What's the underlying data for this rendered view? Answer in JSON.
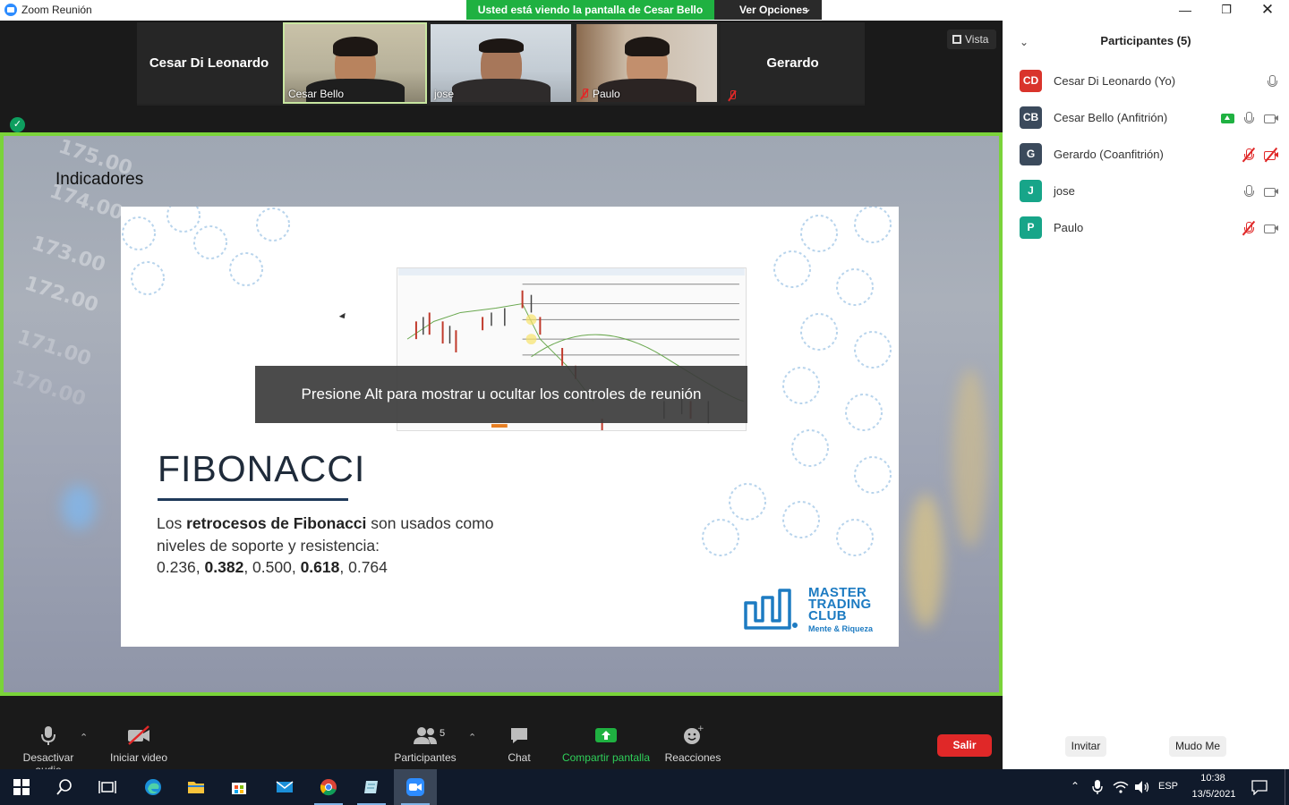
{
  "window": {
    "title": "Zoom Reunión",
    "share_banner": "Usted está viendo la pantalla de Cesar Bello",
    "view_options": "Ver Opciones"
  },
  "video_strip": {
    "tiles": [
      {
        "name": "Cesar Di Leonardo",
        "type": "name-only"
      },
      {
        "name": "Cesar Bello",
        "type": "video",
        "active": true
      },
      {
        "name": "jose",
        "type": "video"
      },
      {
        "name": "Paulo",
        "type": "video",
        "muted": true
      },
      {
        "name": "Gerardo",
        "type": "name-only",
        "muted": true
      }
    ],
    "vista_label": "Vista"
  },
  "shared_screen": {
    "section_title": "Indicadores",
    "chart_ticks": [
      "175.00",
      "174.00",
      "173.00",
      "172.00",
      "171.00",
      "170.00"
    ],
    "slide": {
      "heading": "FIBONACCI",
      "text_1": "Los ",
      "text_bold_1": "retrocesos de Fibonacci",
      "text_2": " son usados como",
      "text_3": "niveles de soporte y resistencia:",
      "v1": "0.236, ",
      "v2": "0.382",
      "v3": ", 0.500, ",
      "v4": "0.618",
      "v5": ", 0.764",
      "logo_line1": "MASTER",
      "logo_line2": "TRADING",
      "logo_line3": "CLUB",
      "logo_tagline": "Mente & Riqueza"
    },
    "toast": "Presione Alt para mostrar u ocultar los controles de reunión"
  },
  "toolbar": {
    "audio": "Desactivar audio",
    "video": "Iniciar video",
    "participants": "Participantes",
    "participants_count": "5",
    "chat": "Chat",
    "share": "Compartir pantalla",
    "reactions": "Reacciones",
    "leave": "Salir"
  },
  "panel": {
    "title": "Participantes (5)",
    "participants": [
      {
        "initials": "CD",
        "name": "Cesar Di Leonardo (Yo)",
        "color": "#d9342b"
      },
      {
        "initials": "CB",
        "name": "Cesar Bello (Anfitrión)",
        "color": "#3b4a5c"
      },
      {
        "initials": "G",
        "name": "Gerardo (Coanfitrión)",
        "color": "#3b4a5c"
      },
      {
        "initials": "J",
        "name": "jose",
        "color": "#17a589"
      },
      {
        "initials": "P",
        "name": "Paulo",
        "color": "#17a589"
      }
    ],
    "invite": "Invitar",
    "mute_me": "Mudo Me"
  },
  "taskbar": {
    "lang": "ESP",
    "time": "10:38",
    "date": "13/5/2021"
  },
  "colors": {
    "share_green": "#1fb141",
    "leave_red": "#e02828",
    "frame_green": "#7ad33a",
    "brand_blue": "#1d7bc2"
  }
}
